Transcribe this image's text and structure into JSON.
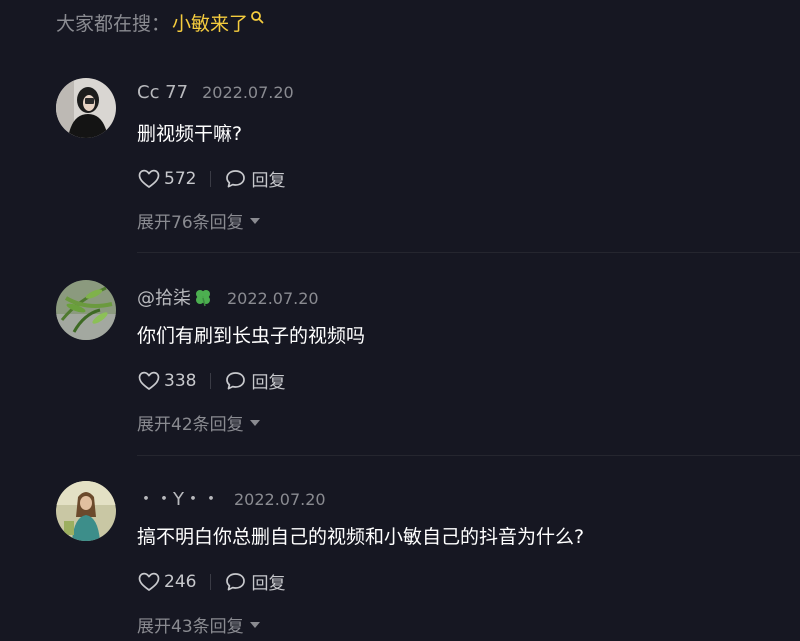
{
  "search_hint": {
    "label": "大家都在搜：",
    "term": "小敏来了",
    "icon": "search-icon"
  },
  "reply_label": "回复",
  "colors": {
    "background": "#161722",
    "search_term": "#f5cc3e",
    "text": "#ffffff",
    "muted": "#8a8b91"
  },
  "comments": [
    {
      "username": "Cc 77",
      "date": "2022.07.20",
      "content": "删视频干嘛?",
      "likes": "572",
      "expand": "展开76条回复"
    },
    {
      "username": "@拾柒",
      "username_emoji": "clover-icon",
      "date": "2022.07.20",
      "content": "你们有刷到长虫子的视频吗",
      "likes": "338",
      "expand": "展开42条回复"
    },
    {
      "username": "・・Y・・",
      "date": "2022.07.20",
      "content": "搞不明白你总删自己的视频和小敏自己的抖音为什么?",
      "likes": "246",
      "expand": "展开43条回复"
    }
  ]
}
